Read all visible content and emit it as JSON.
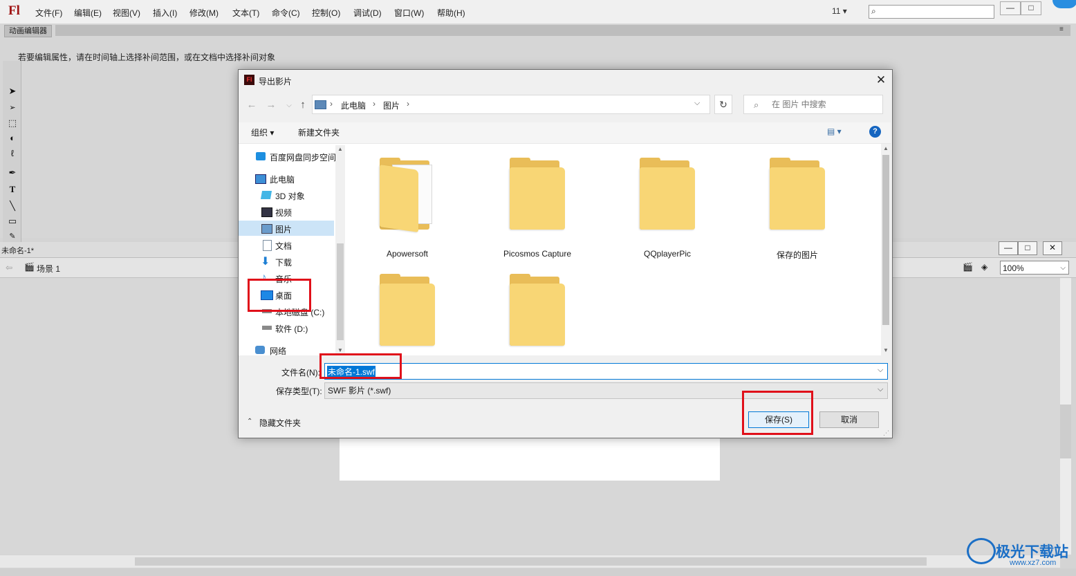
{
  "app": {
    "logo": "Fl",
    "menu": [
      "文件(F)",
      "编辑(E)",
      "视图(V)",
      "插入(I)",
      "修改(M)",
      "文本(T)",
      "命令(C)",
      "控制(O)",
      "调试(D)",
      "窗口(W)",
      "帮助(H)"
    ],
    "workspace_label": "11 ▾",
    "window_controls": [
      "—",
      "□",
      "✕"
    ]
  },
  "motion_editor": {
    "tab_label": "动画编辑器",
    "hint": "若要编辑属性，请在时间轴上选择补间范围，或在文档中选择补间对象"
  },
  "document": {
    "tab_label": "未命名-1*",
    "scene_label": "场景 1",
    "zoom": "100%",
    "window_controls": [
      "—",
      "□",
      "✕"
    ]
  },
  "dialog": {
    "title": "导出影片",
    "title_icon": "Fl",
    "breadcrumb": [
      "此电脑",
      "图片"
    ],
    "search_placeholder": "在 图片 中搜索",
    "toolbar": {
      "organize": "组织 ▾",
      "new_folder": "新建文件夹",
      "view": "▤ ▾",
      "help": "?"
    },
    "nav": [
      {
        "label": "百度网盘同步空间",
        "icon": "baidu-cloud-icon"
      },
      {
        "label": "此电脑",
        "icon": "computer-icon"
      },
      {
        "label": "3D 对象",
        "icon": "3d-objects-icon"
      },
      {
        "label": "视频",
        "icon": "video-icon"
      },
      {
        "label": "图片",
        "icon": "pictures-icon"
      },
      {
        "label": "文档",
        "icon": "documents-icon"
      },
      {
        "label": "下载",
        "icon": "download-icon"
      },
      {
        "label": "音乐",
        "icon": "music-icon"
      },
      {
        "label": "桌面",
        "icon": "desktop-icon"
      },
      {
        "label": "本地磁盘 (C:)",
        "icon": "drive-icon"
      },
      {
        "label": "软件 (D:)",
        "icon": "drive-icon"
      },
      {
        "label": "网络",
        "icon": "network-icon"
      }
    ],
    "folders": [
      "Apowersoft",
      "Picosmos Capture",
      "QQplayerPic",
      "保存的图片",
      "",
      ""
    ],
    "filename_label": "文件名(N):",
    "filename_value": "未命名-1.swf",
    "filetype_label": "保存类型(T):",
    "filetype_value": "SWF 影片 (*.swf)",
    "hide_folders": "隐藏文件夹",
    "save": "保存(S)",
    "cancel": "取消",
    "close": "✕"
  },
  "watermark": {
    "text": "极光下载站",
    "url": "www.xz7.com"
  },
  "colors": {
    "accent": "#0078d7",
    "highlight_box": "#e0101a",
    "folder": "#f8d675"
  }
}
